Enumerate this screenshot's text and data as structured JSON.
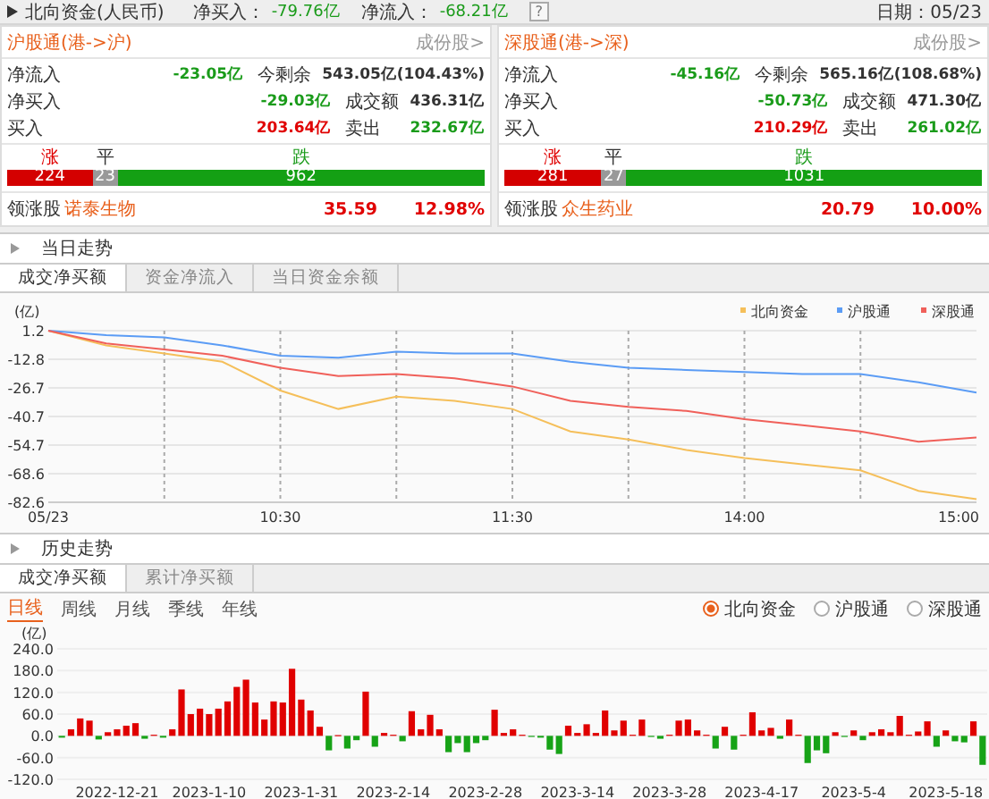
{
  "top_bar": {
    "title": "北向资金(人民币)",
    "net_buy_label": "净买入：",
    "net_buy": "-79.76亿",
    "net_inflow_label": "净流入：",
    "net_inflow": "-68.21亿",
    "help": "?",
    "date": "日期：05/23"
  },
  "panels": [
    {
      "title": "沪股通(港->沪)",
      "link": "成份股>",
      "rows": [
        [
          {
            "label": "净流入",
            "value": "-23.05亿",
            "color": "#1a9b1a"
          },
          {
            "label": "今剩余",
            "value": "543.05亿(104.43%)",
            "color": "#333333"
          }
        ],
        [
          {
            "label": "净买入",
            "value": "-29.03亿",
            "color": "#1a9b1a"
          },
          {
            "label": "成交额",
            "value": "436.31亿",
            "color": "#333333"
          }
        ],
        [
          {
            "label": "买入",
            "value": "203.64亿",
            "color": "#e00000"
          },
          {
            "label": "卖出",
            "value": "232.67亿",
            "color": "#1a9b1a"
          }
        ]
      ],
      "breadth": {
        "up_label": "涨",
        "flat_label": "平",
        "down_label": "跌",
        "up": "224",
        "flat": "23",
        "down": "962"
      },
      "leader": {
        "label": "领涨股",
        "name": "诺泰生物",
        "price": "35.59",
        "change": "12.98%"
      }
    },
    {
      "title": "深股通(港->深)",
      "link": "成份股>",
      "rows": [
        [
          {
            "label": "净流入",
            "value": "-45.16亿",
            "color": "#1a9b1a"
          },
          {
            "label": "今剩余",
            "value": "565.16亿(108.68%)",
            "color": "#333333"
          }
        ],
        [
          {
            "label": "净买入",
            "value": "-50.73亿",
            "color": "#1a9b1a"
          },
          {
            "label": "成交额",
            "value": "471.30亿",
            "color": "#333333"
          }
        ],
        [
          {
            "label": "买入",
            "value": "210.29亿",
            "color": "#e00000"
          },
          {
            "label": "卖出",
            "value": "261.02亿",
            "color": "#1a9b1a"
          }
        ]
      ],
      "breadth": {
        "up_label": "涨",
        "flat_label": "平",
        "down_label": "跌",
        "up": "281",
        "flat": "27",
        "down": "1031"
      },
      "leader": {
        "label": "领涨股",
        "name": "众生药业",
        "price": "20.79",
        "change": "10.00%"
      }
    }
  ],
  "today": {
    "title": "当日走势",
    "tabs": [
      {
        "label": "成交净买额",
        "selected": true
      },
      {
        "label": "资金净流入",
        "selected": false
      },
      {
        "label": "当日资金余额",
        "selected": false
      }
    ],
    "chart_data": {
      "type": "line",
      "ylabel": "(亿)",
      "categories": [
        "05/23",
        null,
        null,
        null,
        "10:30",
        null,
        null,
        null,
        "11:30",
        null,
        null,
        null,
        "14:00",
        null,
        null,
        null,
        "15:00"
      ],
      "yticks": [
        1.2,
        -12.8,
        -26.7,
        -40.7,
        -54.7,
        -68.6,
        -82.6
      ],
      "ylim": [
        -82.6,
        1.2
      ],
      "grid": true,
      "legend": true,
      "series": [
        {
          "name": "北向资金",
          "color": "#f5bf5a",
          "values": [
            1.2,
            -6,
            -10,
            -14,
            -28,
            -37,
            -31,
            -33,
            -37,
            -48,
            -52,
            -57,
            -61,
            -64,
            -67,
            -77,
            -81
          ]
        },
        {
          "name": "沪股通",
          "color": "#5b9cf5",
          "values": [
            1.2,
            -1,
            -2,
            -6,
            -11,
            -12,
            -9,
            -10,
            -10,
            -14,
            -17,
            -18,
            -19,
            -20,
            -20,
            -24,
            -29
          ]
        },
        {
          "name": "深股通",
          "color": "#f0605a",
          "values": [
            1.2,
            -5,
            -8,
            -11,
            -17,
            -21,
            -20,
            -22,
            -26,
            -33,
            -36,
            -38,
            -42,
            -45,
            -48,
            -53,
            -51
          ]
        }
      ]
    }
  },
  "history": {
    "title": "历史走势",
    "tabs": [
      {
        "label": "成交净买额",
        "selected": true
      },
      {
        "label": "累计净买额",
        "selected": false
      }
    ],
    "periods": [
      {
        "label": "日线",
        "selected": true
      },
      {
        "label": "周线",
        "selected": false
      },
      {
        "label": "月线",
        "selected": false
      },
      {
        "label": "季线",
        "selected": false
      },
      {
        "label": "年线",
        "selected": false
      }
    ],
    "options": [
      {
        "label": "北向资金",
        "selected": true
      },
      {
        "label": "沪股通",
        "selected": false
      },
      {
        "label": "深股通",
        "selected": false
      }
    ],
    "chart_data": {
      "type": "bar",
      "ylabel": "(亿)",
      "categories": [
        null,
        null,
        null,
        null,
        null,
        null,
        "2022-12-21",
        null,
        null,
        null,
        null,
        null,
        null,
        null,
        null,
        null,
        "2023-1-10",
        null,
        null,
        null,
        null,
        null,
        null,
        null,
        null,
        null,
        "2023-1-31",
        null,
        null,
        null,
        null,
        null,
        null,
        null,
        null,
        null,
        "2023-2-14",
        null,
        null,
        null,
        null,
        null,
        null,
        null,
        null,
        null,
        "2023-2-28",
        null,
        null,
        null,
        null,
        null,
        null,
        null,
        null,
        null,
        "2023-3-14",
        null,
        null,
        null,
        null,
        null,
        null,
        null,
        null,
        null,
        "2023-3-28",
        null,
        null,
        null,
        null,
        null,
        null,
        null,
        null,
        null,
        "2023-4-17",
        null,
        null,
        null,
        null,
        null,
        null,
        null,
        null,
        null,
        "2023-5-4",
        null,
        null,
        null,
        null,
        null,
        null,
        null,
        null,
        null,
        "2023-5-18",
        null,
        null,
        null,
        null
      ],
      "yticks": [
        {
          "value": 240,
          "label": "240.0"
        },
        {
          "value": 180,
          "label": "180.0"
        },
        {
          "value": 120,
          "label": "120.0"
        },
        {
          "value": 60,
          "label": "60.0"
        },
        {
          "value": 0,
          "label": "0.0"
        },
        {
          "value": -60,
          "label": "-60.0"
        },
        {
          "value": -120,
          "label": "-120.0"
        }
      ],
      "ylim": [
        -120,
        240
      ],
      "grid": true,
      "values": [
        -5,
        18,
        48,
        42,
        -10,
        10,
        18,
        28,
        35,
        -8,
        3,
        -5,
        18,
        128,
        60,
        75,
        60,
        75,
        95,
        135,
        155,
        92,
        45,
        95,
        92,
        185,
        100,
        70,
        25,
        -40,
        2,
        -35,
        -12,
        122,
        -30,
        8,
        3,
        -15,
        68,
        18,
        58,
        18,
        -45,
        -20,
        -45,
        -20,
        -12,
        72,
        8,
        18,
        3,
        -2,
        -5,
        -38,
        -50,
        28,
        8,
        32,
        8,
        70,
        15,
        42,
        3,
        45,
        -3,
        -8,
        3,
        42,
        45,
        15,
        3,
        -35,
        25,
        -38,
        3,
        65,
        15,
        22,
        -8,
        45,
        3,
        -75,
        -40,
        -48,
        10,
        -3,
        15,
        -12,
        10,
        18,
        10,
        55,
        3,
        12,
        40,
        -30,
        15,
        -15,
        -18,
        40,
        -80
      ]
    }
  }
}
